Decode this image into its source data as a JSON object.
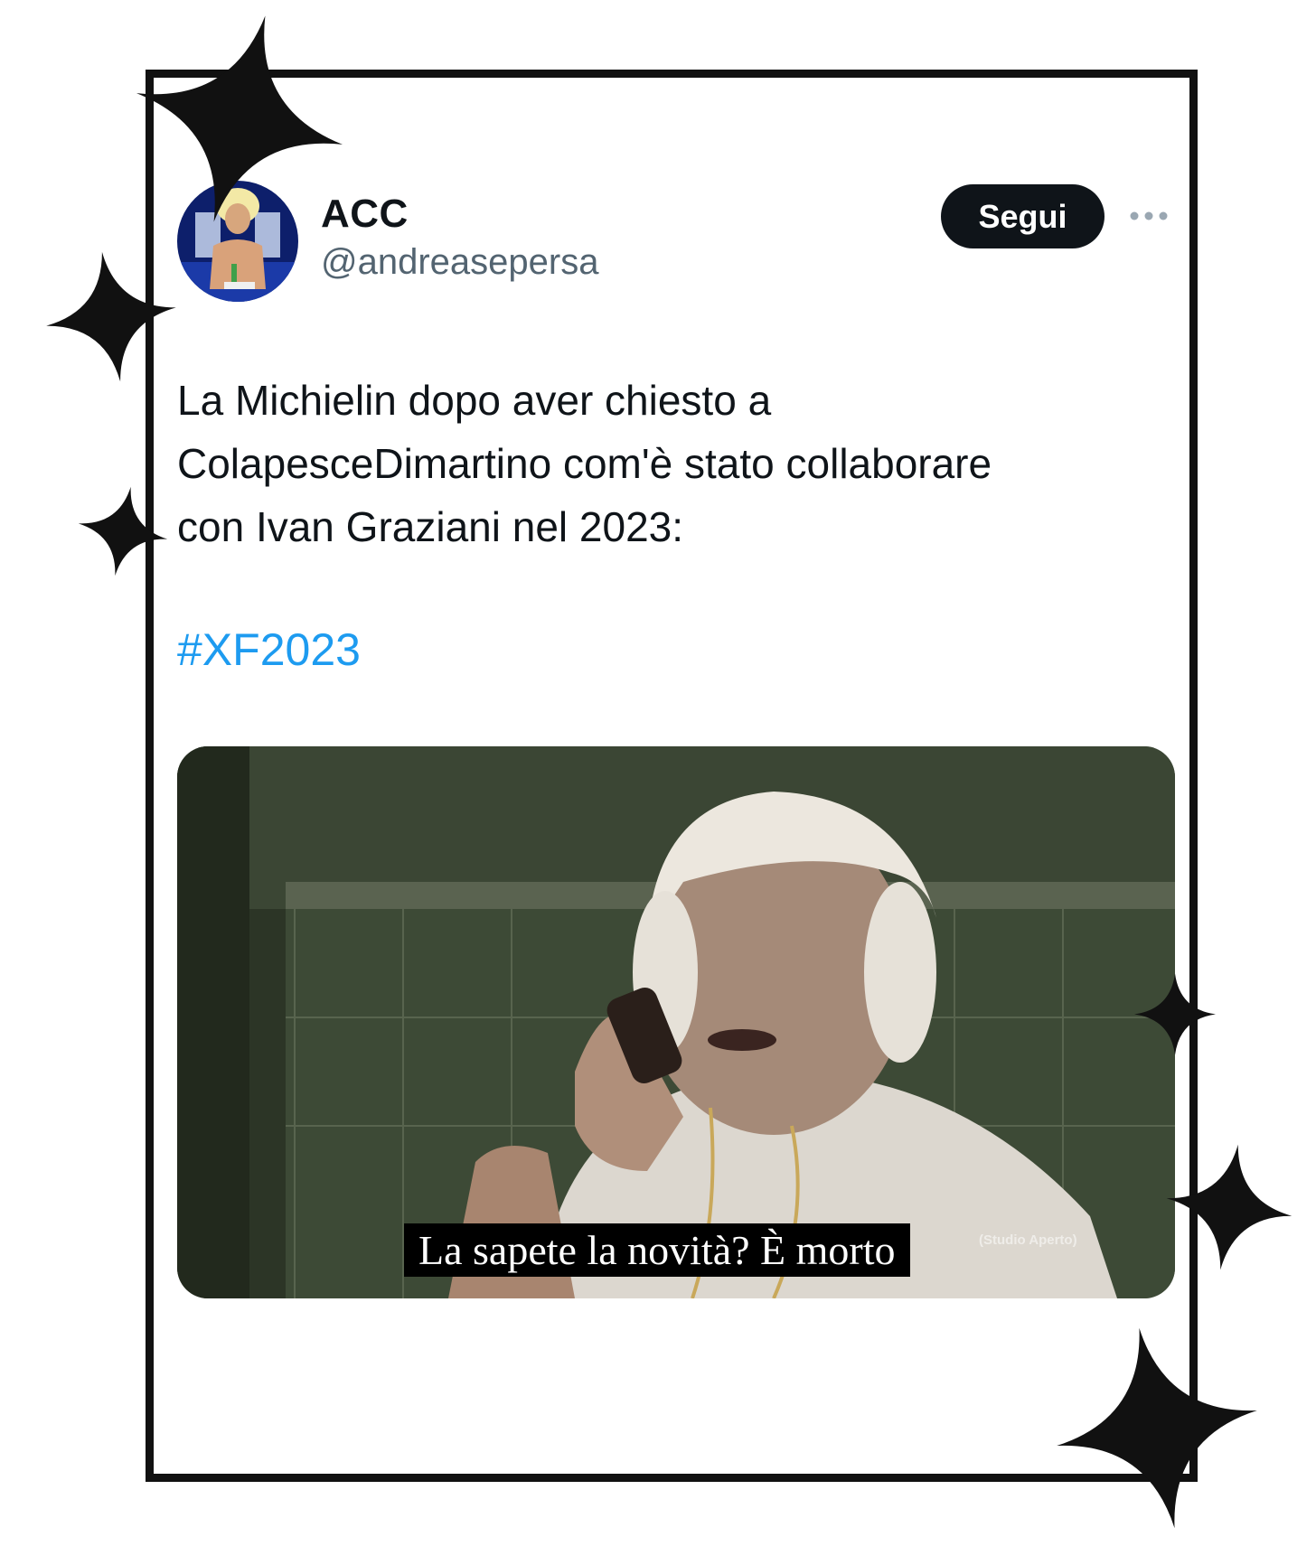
{
  "tweet": {
    "display_name": "ACC",
    "handle": "@andreasepersa",
    "follow_label": "Segui",
    "more_icon": "more-horizontal-icon",
    "text": "La Michielin dopo aver chiesto a\nColapesceDimartino com'è stato collaborare\ncon Ivan Graziani nel 2023:",
    "hashtag": "#XF2023",
    "media": {
      "subtitle": "La sapete la novità? È morto",
      "watermark": "(Studio Aperto)"
    }
  },
  "decoration": {
    "star_color": "#111111",
    "frame_color": "#111111"
  },
  "colors": {
    "text": "#0f1419",
    "secondary": "#536471",
    "link": "#1d9bf0",
    "button_bg": "#0f1419"
  }
}
